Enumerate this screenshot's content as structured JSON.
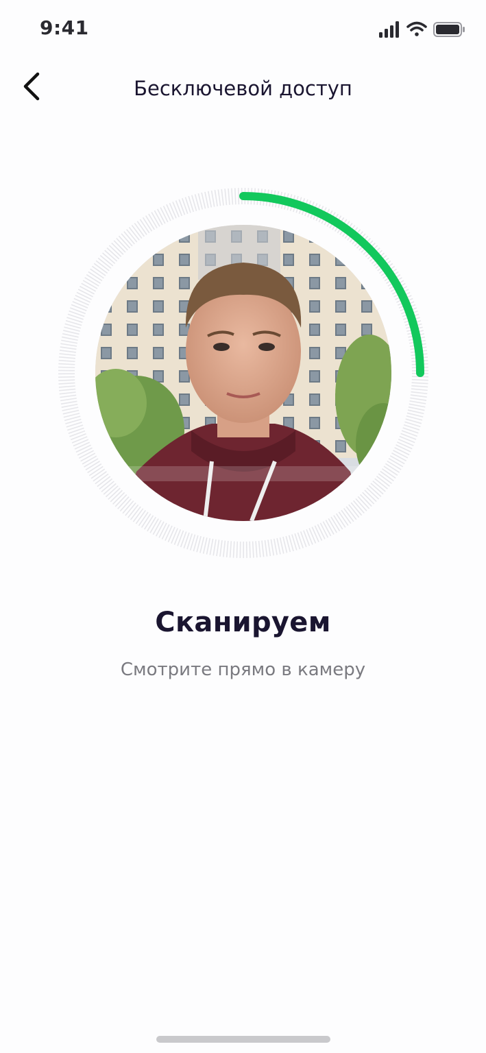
{
  "status_bar": {
    "time": "9:41",
    "icons": [
      "signal-icon",
      "wifi-icon",
      "battery-icon"
    ]
  },
  "nav": {
    "back_icon": "chevron-left-icon",
    "title": "Бесключевой доступ"
  },
  "scanner": {
    "progress": 0.25,
    "progress_color": "#12c85c",
    "track_color": "#e6e6ea"
  },
  "scan": {
    "title": "Сканируем",
    "subtitle": "Смотрите прямо в камеру"
  },
  "colors": {
    "title": "#1a1530",
    "subtitle": "#7a7a80",
    "background": "#fdfdfe"
  }
}
